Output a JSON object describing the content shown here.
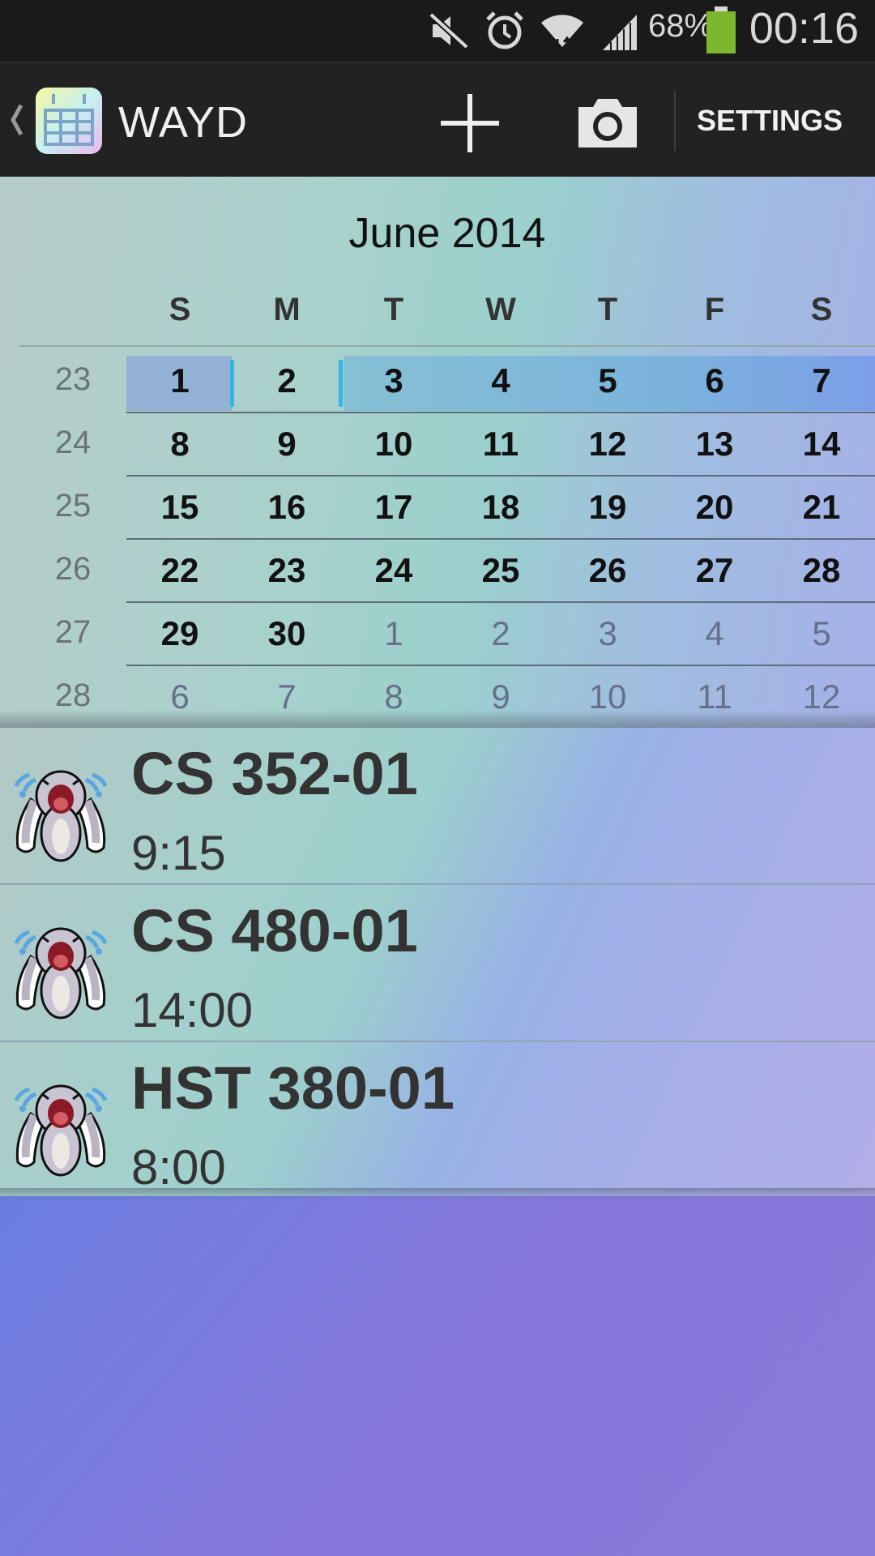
{
  "status_bar": {
    "battery_percent": "68%",
    "battery_color": "#7cb82f",
    "time": "00:16",
    "icons": [
      "mute-icon",
      "alarm-icon",
      "wifi-icon",
      "signal-icon",
      "battery-icon"
    ]
  },
  "action_bar": {
    "title": "WAYD",
    "add_icon": "plus-icon",
    "camera_icon": "camera-icon",
    "settings_label": "SETTINGS"
  },
  "calendar": {
    "month_title": "June 2014",
    "weekdays": [
      "S",
      "M",
      "T",
      "W",
      "T",
      "F",
      "S"
    ],
    "selected_day": "1",
    "highlight_color": "#36b5e6",
    "weeks": [
      {
        "number": "23",
        "days": [
          "1",
          "2",
          "3",
          "4",
          "5",
          "6",
          "7"
        ],
        "other_month": [
          false,
          false,
          false,
          false,
          false,
          false,
          false
        ]
      },
      {
        "number": "24",
        "days": [
          "8",
          "9",
          "10",
          "11",
          "12",
          "13",
          "14"
        ],
        "other_month": [
          false,
          false,
          false,
          false,
          false,
          false,
          false
        ]
      },
      {
        "number": "25",
        "days": [
          "15",
          "16",
          "17",
          "18",
          "19",
          "20",
          "21"
        ],
        "other_month": [
          false,
          false,
          false,
          false,
          false,
          false,
          false
        ]
      },
      {
        "number": "26",
        "days": [
          "22",
          "23",
          "24",
          "25",
          "26",
          "27",
          "28"
        ],
        "other_month": [
          false,
          false,
          false,
          false,
          false,
          false,
          false
        ]
      },
      {
        "number": "27",
        "days": [
          "29",
          "30",
          "1",
          "2",
          "3",
          "4",
          "5"
        ],
        "other_month": [
          false,
          false,
          true,
          true,
          true,
          true,
          true
        ]
      },
      {
        "number": "28",
        "days": [
          "6",
          "7",
          "8",
          "9",
          "10",
          "11",
          "12"
        ],
        "other_month": [
          true,
          true,
          true,
          true,
          true,
          true,
          true
        ]
      }
    ]
  },
  "events": [
    {
      "title": "CS 352-01",
      "time": "9:15",
      "icon": "crying-bunny-icon"
    },
    {
      "title": "CS 480-01",
      "time": "14:00",
      "icon": "crying-bunny-icon"
    },
    {
      "title": "HST 380-01",
      "time": "8:00",
      "icon": "crying-bunny-icon"
    }
  ]
}
